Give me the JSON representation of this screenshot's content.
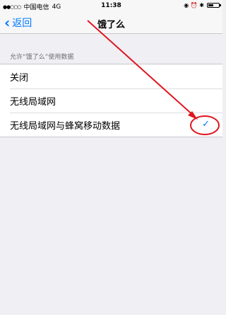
{
  "status_bar": {
    "signal": "●●○○○",
    "carrier": "中国电信",
    "network": "4G",
    "time": "11:38",
    "right_icons": "◉ ⏰ ✱"
  },
  "nav": {
    "back_label": "返回",
    "title": "饿了么"
  },
  "section": {
    "header": "允许“饿了么”使用数据"
  },
  "options": [
    {
      "label": "关闭"
    },
    {
      "label": "无线局域网"
    },
    {
      "label": "无线局域网与蜂窝移动数据",
      "checkmark": "✓",
      "selected": true
    }
  ],
  "annotation": {
    "color": "#e0141e"
  }
}
